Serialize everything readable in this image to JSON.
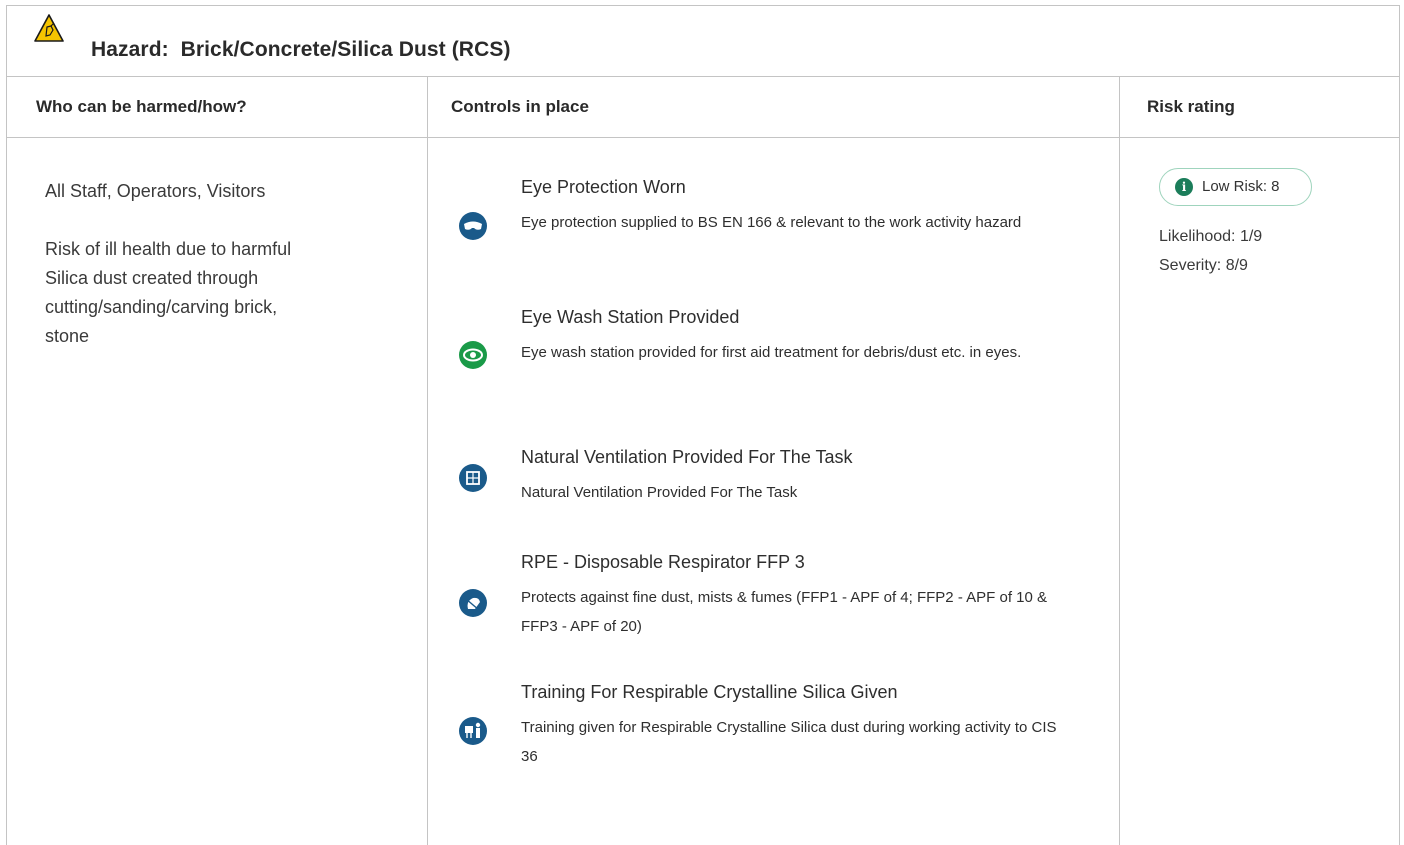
{
  "hazard": {
    "label": "Hazard:",
    "name": "Brick/Concrete/Silica Dust (RCS)",
    "title": "Hazard:  Brick/Concrete/Silica Dust (RCS)",
    "icon": "warning-triangle-icon"
  },
  "columns": {
    "who": "Who can be harmed/how?",
    "controls": "Controls in place",
    "risk": "Risk rating"
  },
  "who": {
    "people": "All Staff, Operators, Visitors",
    "description_lines": [
      "Risk of ill health due to harmful",
      "Silica dust created through",
      "cutting/sanding/carving brick,",
      "stone"
    ]
  },
  "controls": [
    {
      "title": "Eye Protection Worn",
      "description": "Eye protection supplied to BS EN 166 & relevant to the work activity hazard",
      "icon": "safety-goggles-icon",
      "color": "#1a5a8a"
    },
    {
      "title": "Eye Wash Station Provided",
      "description": "Eye wash station provided for first aid treatment for debris/dust etc. in eyes.",
      "icon": "eye-wash-icon",
      "color": "#1a9a48"
    },
    {
      "title": "Natural Ventilation Provided For The Task",
      "description": "Natural Ventilation Provided For The Task",
      "icon": "ventilation-window-icon",
      "color": "#1a5a8a"
    },
    {
      "title": "RPE - Disposable Respirator FFP 3",
      "description": "Protects against fine dust, mists & fumes (FFP1 - APF of 4; FFP2 - APF of 10 & FFP3 - APF of 20)",
      "icon": "respirator-mask-icon",
      "color": "#1a5a8a"
    },
    {
      "title": "Training For Respirable Crystalline Silica Given",
      "description": "Training given for Respirable Crystalline Silica dust during working activity to CIS 36",
      "icon": "training-presenter-icon",
      "color": "#1a5a8a"
    }
  ],
  "risk": {
    "badge": "Low Risk: 8",
    "likelihood": "Likelihood: 1/9",
    "severity": "Severity: 8/9",
    "badge_color": "#1b7d5a",
    "badge_border": "#9fd4bd"
  }
}
